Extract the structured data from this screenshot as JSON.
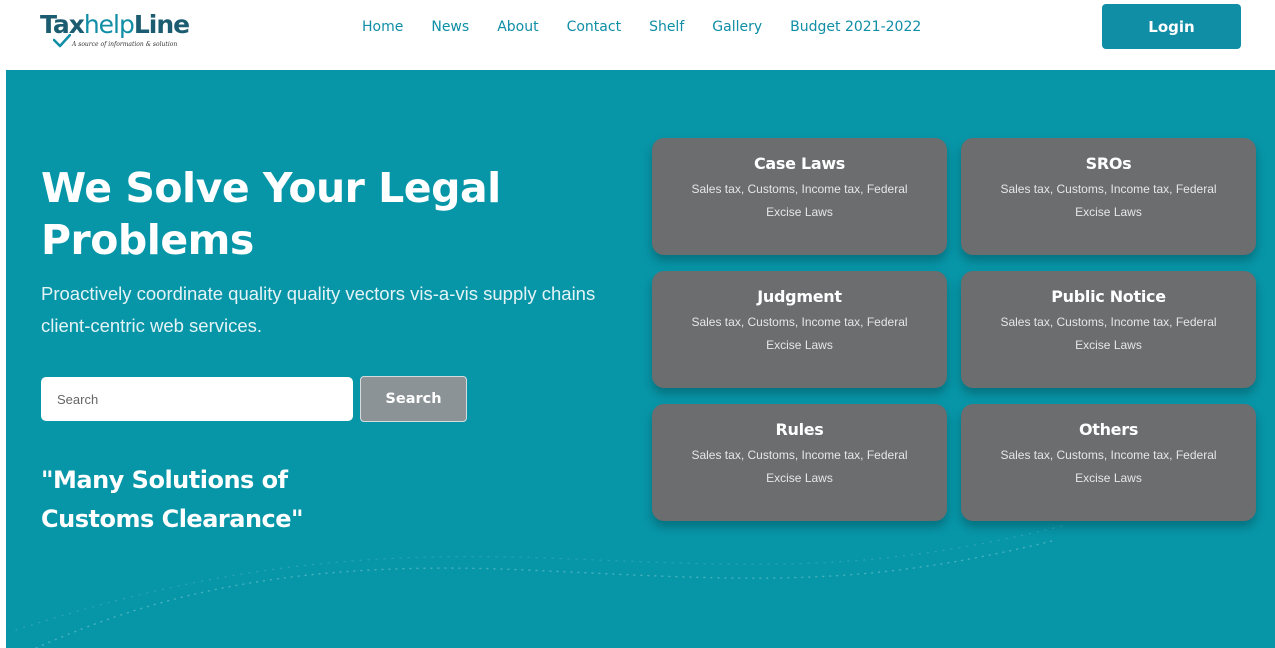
{
  "header": {
    "logo": {
      "tax": "Tax",
      "help": "help",
      "line": "Line",
      "tagline": "A source of information & solution"
    },
    "nav": [
      "Home",
      "News",
      "About",
      "Contact",
      "Shelf",
      "Gallery",
      "Budget 2021-2022"
    ],
    "login_label": "Login"
  },
  "hero": {
    "title": "We Solve Your Legal Problems",
    "description": "Proactively coordinate quality quality vectors vis-a-vis supply chains client-centric web services.",
    "search_placeholder": "Search",
    "search_button": "Search",
    "tagline": "\"Many Solutions of Customs Clearance\""
  },
  "cards": [
    {
      "title": "Case Laws",
      "desc": "Sales tax, Customs, Income tax, Federal Excise Laws"
    },
    {
      "title": "SROs",
      "desc": "Sales tax, Customs, Income tax, Federal Excise Laws"
    },
    {
      "title": "Judgment",
      "desc": "Sales tax, Customs, Income tax, Federal Excise Laws"
    },
    {
      "title": "Public Notice",
      "desc": "Sales tax, Customs, Income tax, Federal Excise Laws"
    },
    {
      "title": "Rules",
      "desc": "Sales tax, Customs, Income tax, Federal Excise Laws"
    },
    {
      "title": "Others",
      "desc": "Sales tax, Customs, Income tax, Federal Excise Laws"
    }
  ],
  "colors": {
    "brand": "#0f8ea6",
    "brand_dark": "#1b5c70",
    "hero_bg": "#0796a8",
    "card_bg": "#6b6d6e",
    "search_button_bg": "#8c9396"
  },
  "icons": {
    "logo_check": "checkmark-icon"
  }
}
